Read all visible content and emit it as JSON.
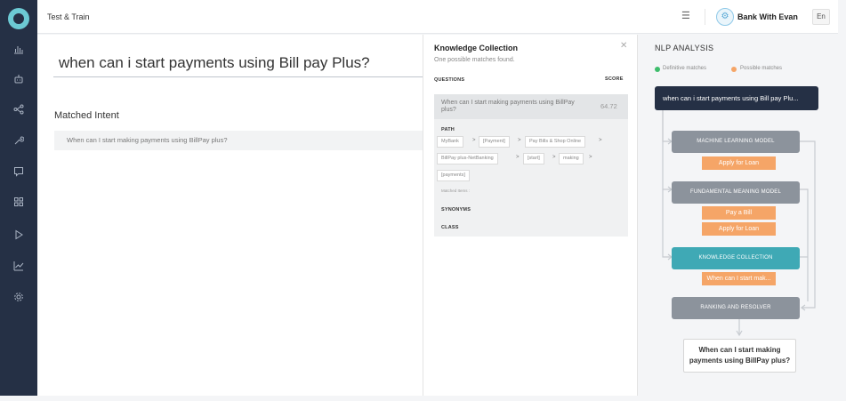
{
  "header": {
    "page_title": "Test & Train",
    "bot_name": "Bank With Evan",
    "language": "En"
  },
  "sidebar": {
    "items": [
      {
        "name": "analytics",
        "icon": "bar-chart-icon"
      },
      {
        "name": "bot-builder",
        "icon": "robot-icon"
      },
      {
        "name": "flows",
        "icon": "share-icon"
      },
      {
        "name": "test-train",
        "icon": "wrench-icon"
      },
      {
        "name": "messages",
        "icon": "chat-icon"
      },
      {
        "name": "apps",
        "icon": "grid-icon"
      },
      {
        "name": "publish",
        "icon": "play-icon"
      },
      {
        "name": "metrics",
        "icon": "line-chart-icon"
      },
      {
        "name": "settings",
        "icon": "gear-icon"
      }
    ]
  },
  "main": {
    "utterance": "when can i start payments using Bill pay Plus?",
    "matched_heading": "Matched Intent",
    "matched_intent": "When can I start making payments using BillPay plus?"
  },
  "knowledge_collection": {
    "title": "Knowledge Collection",
    "subtitle": "One possible matches found.",
    "col_questions": "QUESTIONS",
    "col_score": "SCORE",
    "result_question": "When can I start making payments using BillPay plus?",
    "result_score": "64.72",
    "path_label": "PATH",
    "path": [
      "MyBank",
      "[Payment]",
      "Pay Bills & Shop Online",
      "BillPay plus-NetBanking",
      "[start]",
      "making",
      "[payments]"
    ],
    "path_separator": ">",
    "matched_items_label": "Matched Items :",
    "synonyms_label": "SYNONYMS",
    "class_label": "CLASS"
  },
  "nlp": {
    "title": "NLP ANALYSIS",
    "legend_definitive": "Definitive matches",
    "legend_possible": "Possible matches",
    "input_text": "when can i start payments using Bill pay Plu...",
    "models": {
      "ml": "MACHINE LEARNING MODEL",
      "fm": "FUNDAMENTAL MEANING MODEL",
      "kc": "KNOWLEDGE COLLECTION",
      "rr": "RANKING AND RESOLVER"
    },
    "ml_tags": [
      "Apply for Loan"
    ],
    "fm_tags": [
      "Pay a Bill",
      "Apply for Loan"
    ],
    "kc_tags": [
      "When can I start mak..."
    ],
    "final_result": "When can I start making payments using BillPay plus?",
    "colors": {
      "definitive": "#3ebd6c",
      "possible": "#f5a567",
      "active_model": "#3fa9b5",
      "inactive_model": "#8c939c",
      "input_bg": "#253045"
    }
  }
}
